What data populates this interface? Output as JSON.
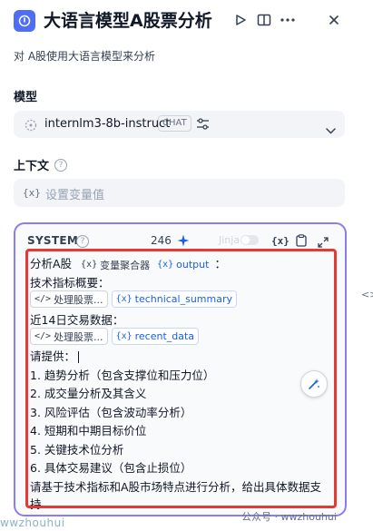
{
  "header": {
    "title": "大语言模型A股票分析",
    "description": "对 A股使用大语言模型来分析"
  },
  "model_section": {
    "label": "模型",
    "model_name": "internlm3-8b-instruct",
    "mode_badge": "CHAT"
  },
  "context_section": {
    "label": "上下文",
    "var_glyph": "{x}",
    "placeholder": "设置变量值"
  },
  "system_prompt": {
    "label": "SYSTEM",
    "token_count": "246",
    "jinja_label": "Jinja",
    "jinja_enabled": false,
    "toolbar_var_glyph": "{x}",
    "lines": {
      "l1_text": "分析A股",
      "l1_chip1": "变量聚合器",
      "l1_chip2": "output",
      "l1_tail": "：",
      "l2": "技术指标概要：",
      "l3_chip1": "处理股票...",
      "l3_chip2": "technical_summary",
      "l4": "近14日交易数据：",
      "l5_chip1": "处理股票...",
      "l5_chip2": "recent_data",
      "l6": "请提供：",
      "l7": "1. 趋势分析（包含支撑位和压力位）",
      "l8": "2. 成交量分析及其含义",
      "l9": "3. 风险评估（包含波动率分析）",
      "l10": "4. 短期和中期目标价位",
      "l11": "5. 关键技术位分析",
      "l12": "6. 具体交易建议（包含止损位）",
      "l13": "请基于技术指标和A股市场特点进行分析，给出具体数据支",
      "l14": "持"
    },
    "var_glyph": "{x}",
    "code_glyph": "</>"
  },
  "watermarks": {
    "left": "wwzhouhui",
    "right": "公众号 · wwzhouhui"
  },
  "right_edge_text": "<>",
  "colors": {
    "accent": "#4f6ef7",
    "panel_border": "#8b7cf6",
    "highlight_box": "#e53935",
    "variable_blue": "#155eef"
  },
  "icons": [
    "app-icon",
    "play-icon",
    "book-icon",
    "more-icon",
    "close-icon",
    "model-icon",
    "settings-sliders-icon",
    "chevron-down-icon",
    "help-icon",
    "sparkle-icon",
    "clipboard-icon",
    "expand-icon",
    "code-icon",
    "variable-icon",
    "wand-icon"
  ]
}
